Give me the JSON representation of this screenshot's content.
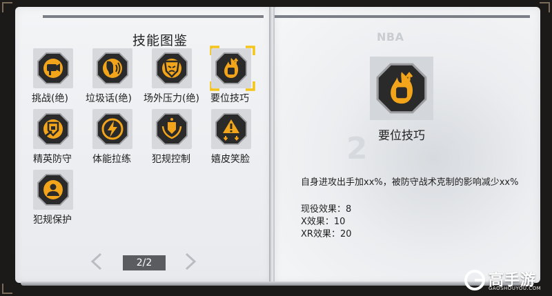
{
  "left_page": {
    "title": "技能图鉴",
    "skills": [
      {
        "label": "挑战(绝)",
        "icon": "camera-icon",
        "selected": false
      },
      {
        "label": "垃圾话(绝)",
        "icon": "talk-icon",
        "selected": false
      },
      {
        "label": "场外压力(绝)",
        "icon": "mask-shield-icon",
        "selected": false
      },
      {
        "label": "要位技巧",
        "icon": "fire-fist-icon",
        "selected": true
      },
      {
        "label": "精英防守",
        "icon": "shield-hand-icon",
        "selected": false
      },
      {
        "label": "体能拉练",
        "icon": "lightning-icon",
        "selected": false
      },
      {
        "label": "犯规控制",
        "icon": "laurel-shield-icon",
        "selected": false
      },
      {
        "label": "嬉皮笑脸",
        "icon": "warning-arrows-icon",
        "selected": false
      },
      {
        "label": "犯规保护",
        "icon": "person-shield-icon",
        "selected": false
      }
    ],
    "pager": {
      "text": "2/2",
      "prev_icon": "chevron-left-icon",
      "next_icon": "chevron-right-icon"
    }
  },
  "right_page": {
    "watermark": "NBA",
    "skill_name": "要位技巧",
    "skill_icon": "fire-fist-icon",
    "description": "自身进攻出手加xx%，被防守战术克制的影响减少xx%",
    "stats": {
      "current": "现役效果：8",
      "x": "X效果：10",
      "xr": "XR效果：20"
    }
  },
  "brand": {
    "name": "高手游",
    "url": "GAOSHOUYOU.COM"
  },
  "colors": {
    "accent_gold": "#f2a51a",
    "badge_dark": "#1e1e1f",
    "selection": "#f4c419"
  }
}
